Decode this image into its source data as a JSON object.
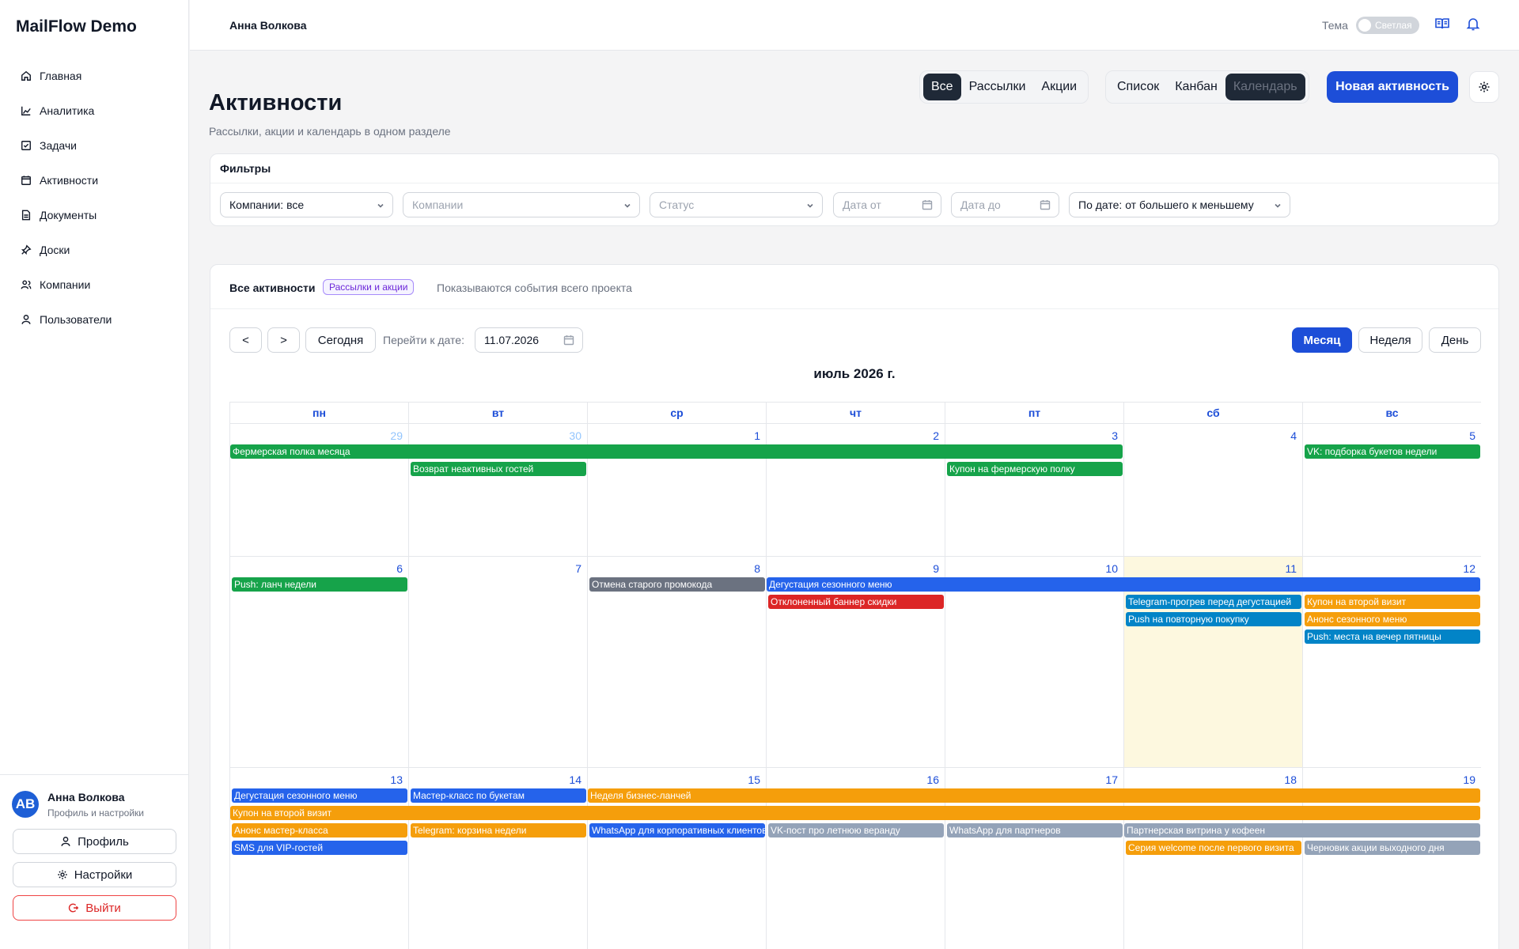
{
  "app": {
    "brand": "MailFlow Demo"
  },
  "sidebar": {
    "items": [
      {
        "label": "Главная",
        "icon": "home-icon"
      },
      {
        "label": "Аналитика",
        "icon": "chart-icon"
      },
      {
        "label": "Задачи",
        "icon": "checkbox-icon"
      },
      {
        "label": "Активности",
        "icon": "calendar-icon"
      },
      {
        "label": "Документы",
        "icon": "document-icon"
      },
      {
        "label": "Доски",
        "icon": "pin-icon"
      },
      {
        "label": "Компании",
        "icon": "users-icon"
      },
      {
        "label": "Пользователи",
        "icon": "user-icon"
      }
    ],
    "user": {
      "initials": "АВ",
      "name": "Анна Волкова",
      "subtitle": "Профиль и настройки"
    },
    "profile_btn": "Профиль",
    "settings_btn": "Настройки",
    "logout_btn": "Выйти"
  },
  "header": {
    "user": "Анна Волкова",
    "theme_label": "Тема",
    "theme_value": "Светлая"
  },
  "page": {
    "title": "Активности",
    "subtitle": "Рассылки, акции и календарь в одном разделе"
  },
  "type_tabs": [
    "Все",
    "Рассылки",
    "Акции"
  ],
  "view_tabs": [
    "Список",
    "Канбан",
    "Календарь"
  ],
  "new_button": "Новая активность",
  "filters": {
    "title": "Фильтры",
    "company_mode": "Компании: все",
    "companies_placeholder": "Компании",
    "status_placeholder": "Статус",
    "date_from_placeholder": "Дата от",
    "date_to_placeholder": "Дата до",
    "sort": "По дате: от большего к меньшему"
  },
  "calendar": {
    "title": "Все активности",
    "badge": "Рассылки и акции",
    "hint": "Показываются события всего проекта",
    "prev": "<",
    "next": ">",
    "today_btn": "Сегодня",
    "goto_label": "Перейти к дате:",
    "goto_value": "11.07.2026",
    "views": [
      "Месяц",
      "Неделя",
      "День"
    ],
    "month_title": "июль 2026 г.",
    "weekdays": [
      "пн",
      "вт",
      "ср",
      "чт",
      "пт",
      "сб",
      "вс"
    ],
    "colors": {
      "green": "#16a34a",
      "blue": "#2563eb",
      "gray": "#6b7280",
      "red": "#dc2626",
      "orange": "#f59e0b",
      "slate": "#94a3b8",
      "sky": "#0284c7"
    },
    "weeks": [
      {
        "days": [
          {
            "num": "29",
            "other": true
          },
          {
            "num": "30",
            "other": true
          },
          {
            "num": "1"
          },
          {
            "num": "2"
          },
          {
            "num": "3"
          },
          {
            "num": "4"
          },
          {
            "num": "5"
          }
        ],
        "events": [
          {
            "title": "Фермерская полка месяца",
            "start": 0,
            "span": 5,
            "row": 0,
            "color": "green"
          },
          {
            "title": "VK: подборка букетов недели",
            "start": 6,
            "span": 1,
            "row": 0,
            "color": "green"
          },
          {
            "title": "Возврат неактивных гостей",
            "start": 1,
            "span": 1,
            "row": 1,
            "color": "green"
          },
          {
            "title": "Купон на фермерскую полку",
            "start": 4,
            "span": 1,
            "row": 1,
            "color": "green"
          }
        ]
      },
      {
        "days": [
          {
            "num": "6"
          },
          {
            "num": "7"
          },
          {
            "num": "8"
          },
          {
            "num": "9"
          },
          {
            "num": "10"
          },
          {
            "num": "11",
            "today": true
          },
          {
            "num": "12"
          }
        ],
        "events": [
          {
            "title": "Push: ланч недели",
            "start": 0,
            "span": 1,
            "row": 0,
            "color": "green"
          },
          {
            "title": "Отмена старого промокода",
            "start": 2,
            "span": 1,
            "row": 0,
            "color": "gray"
          },
          {
            "title": "Дегустация сезонного меню",
            "start": 3,
            "span": 4,
            "row": 0,
            "color": "blue"
          },
          {
            "title": "Отклоненный баннер скидки",
            "start": 3,
            "span": 1,
            "row": 1,
            "color": "red"
          },
          {
            "title": "Telegram-прогрев перед дегустацией",
            "start": 5,
            "span": 1,
            "row": 1,
            "color": "sky"
          },
          {
            "title": "Купон на второй визит",
            "start": 6,
            "span": 1,
            "row": 1,
            "color": "orange"
          },
          {
            "title": "Push на повторную покупку",
            "start": 5,
            "span": 1,
            "row": 2,
            "color": "sky"
          },
          {
            "title": "Анонс сезонного меню",
            "start": 6,
            "span": 1,
            "row": 2,
            "color": "orange"
          },
          {
            "title": "Push: места на вечер пятницы",
            "start": 6,
            "span": 1,
            "row": 3,
            "color": "sky"
          }
        ]
      },
      {
        "days": [
          {
            "num": "13"
          },
          {
            "num": "14"
          },
          {
            "num": "15"
          },
          {
            "num": "16"
          },
          {
            "num": "17"
          },
          {
            "num": "18"
          },
          {
            "num": "19"
          }
        ],
        "events": [
          {
            "title": "Дегустация сезонного меню",
            "start": 0,
            "span": 1,
            "row": 0,
            "color": "blue"
          },
          {
            "title": "Мастер-класс по букетам",
            "start": 1,
            "span": 1,
            "row": 0,
            "color": "blue"
          },
          {
            "title": "Неделя бизнес-ланчей",
            "start": 2,
            "span": 5,
            "row": 0,
            "color": "orange"
          },
          {
            "title": "Купон на второй визит",
            "start": 0,
            "span": 7,
            "row": 1,
            "color": "orange"
          },
          {
            "title": "Анонс мастер-класса",
            "start": 0,
            "span": 1,
            "row": 2,
            "color": "orange"
          },
          {
            "title": "Telegram: корзина недели",
            "start": 1,
            "span": 1,
            "row": 2,
            "color": "orange"
          },
          {
            "title": "WhatsApp для корпоративных клиентов",
            "start": 2,
            "span": 1,
            "row": 2,
            "color": "blue"
          },
          {
            "title": "VK-пост про летнюю веранду",
            "start": 3,
            "span": 1,
            "row": 2,
            "color": "slate"
          },
          {
            "title": "WhatsApp для партнеров",
            "start": 4,
            "span": 1,
            "row": 2,
            "color": "slate"
          },
          {
            "title": "Партнерская витрина у кофеен",
            "start": 5,
            "span": 2,
            "row": 2,
            "color": "slate"
          },
          {
            "title": "SMS для VIP-гостей",
            "start": 0,
            "span": 1,
            "row": 3,
            "color": "blue"
          },
          {
            "title": "Серия welcome после первого визита",
            "start": 5,
            "span": 1,
            "row": 3,
            "color": "orange"
          },
          {
            "title": "Черновик акции выходного дня",
            "start": 6,
            "span": 1,
            "row": 3,
            "color": "slate"
          }
        ]
      }
    ]
  }
}
